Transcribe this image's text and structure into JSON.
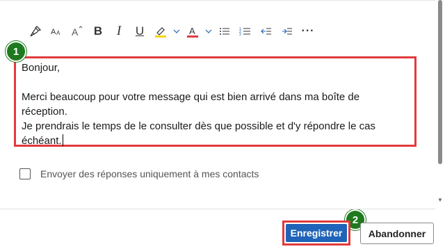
{
  "toolbar": {
    "items": [
      {
        "name": "format-painter",
        "icon": "format-painter-icon"
      },
      {
        "name": "font-size",
        "icon": "font-size-icon"
      },
      {
        "name": "grow-font",
        "icon": "grow-font-icon"
      },
      {
        "name": "bold",
        "label": "B",
        "icon": "bold-icon"
      },
      {
        "name": "italic",
        "label": "I",
        "icon": "italic-icon"
      },
      {
        "name": "underline",
        "label": "U",
        "icon": "underline-icon"
      },
      {
        "name": "highlight",
        "icon": "highlight-icon",
        "color": "#f5d800"
      },
      {
        "name": "font-color",
        "label": "A",
        "icon": "font-color-icon",
        "color": "#e03a3e"
      },
      {
        "name": "bullets",
        "icon": "bulleted-list-icon"
      },
      {
        "name": "numbering",
        "icon": "numbered-list-icon"
      },
      {
        "name": "decrease-indent",
        "icon": "decrease-indent-icon"
      },
      {
        "name": "increase-indent",
        "icon": "increase-indent-icon"
      },
      {
        "name": "more",
        "label": "···",
        "icon": "more-options-icon"
      }
    ]
  },
  "editor": {
    "lines": [
      "Bonjour,",
      "",
      "Merci beaucoup pour votre message qui est bien arrivé dans ma boîte de",
      "réception.",
      "Je prendrais le temps de le consulter dès que possible et d'y répondre le cas",
      "échéant."
    ]
  },
  "checkbox": {
    "label": "Envoyer des réponses uniquement à mes contacts",
    "checked": false
  },
  "actions": {
    "save_label": "Enregistrer",
    "cancel_label": "Abandonner"
  },
  "callouts": {
    "step1": "1",
    "step2": "2",
    "badge_color": "#1f7a1f",
    "highlight_color": "#e03a3e"
  },
  "colors": {
    "primary_button": "#1f64b8"
  }
}
